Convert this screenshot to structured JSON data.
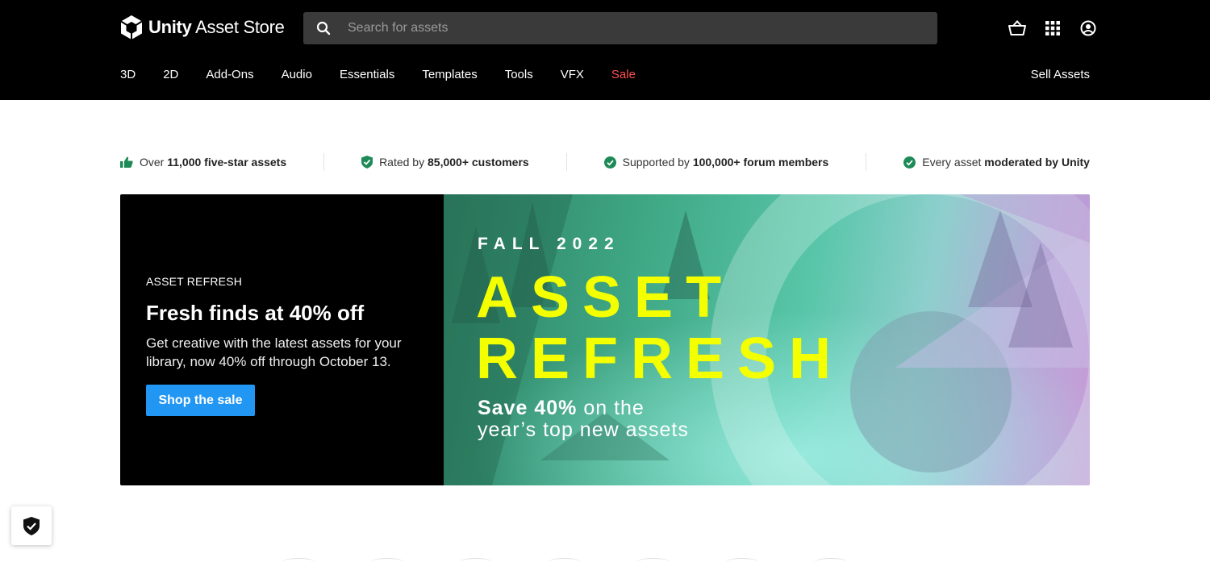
{
  "header": {
    "logo": {
      "bold": "Unity",
      "rest": " Asset Store"
    },
    "search": {
      "placeholder": "Search for assets",
      "icon": "search-icon"
    },
    "icons": [
      "cart-icon",
      "grid-icon",
      "account-icon"
    ],
    "nav": [
      {
        "label": "3D"
      },
      {
        "label": "2D"
      },
      {
        "label": "Add-Ons"
      },
      {
        "label": "Audio"
      },
      {
        "label": "Essentials"
      },
      {
        "label": "Templates"
      },
      {
        "label": "Tools"
      },
      {
        "label": "VFX"
      },
      {
        "label": "Sale"
      }
    ],
    "sell_label": "Sell Assets"
  },
  "trust": [
    {
      "icon": "thumbs-up-icon",
      "pre": "Over ",
      "bold": "11,000 five-star assets"
    },
    {
      "icon": "shield-check-icon",
      "pre": "Rated by ",
      "bold": "85,000+ customers"
    },
    {
      "icon": "check-circle-icon",
      "pre": "Supported by ",
      "bold": "100,000+ forum members"
    },
    {
      "icon": "check-circle-icon",
      "pre": "Every asset ",
      "bold": "moderated by Unity"
    }
  ],
  "banner": {
    "eyebrow": "ASSET REFRESH",
    "headline": "Fresh finds at 40% off",
    "description": "Get creative with the latest assets for your library, now 40% off through October 13.",
    "cta": "Shop the sale",
    "art": {
      "season": "FALL 2022",
      "line1": "ASSET",
      "line2": "REFRESH",
      "save_bold": "Save 40%",
      "save_rest": " on the",
      "save_line2": "year’s top new assets"
    }
  },
  "colors": {
    "header_bg": "#000000",
    "sale": "#ff4f4f",
    "cta": "#2196f3",
    "check": "#1e8a57",
    "banner_title": "#f4ff00"
  },
  "privacy_icon": "privacy-shield-icon"
}
